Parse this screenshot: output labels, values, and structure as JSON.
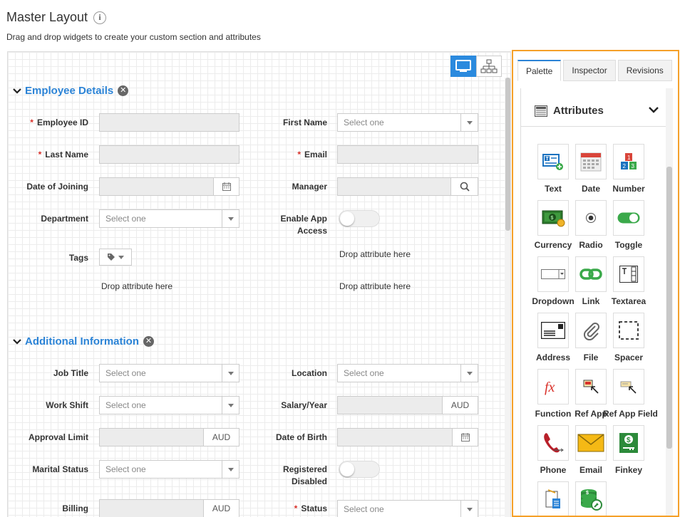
{
  "header": {
    "title": "Master Layout",
    "info_glyph": "i",
    "subtitle": "Drag and drop widgets to create your custom section and attributes"
  },
  "colors": {
    "accent": "#2b83d6",
    "panel_border": "#f5a029",
    "required": "#d9322b"
  },
  "sections": {
    "employee": {
      "title": "Employee Details",
      "fields": {
        "employee_id": {
          "label": "Employee ID",
          "required": "*"
        },
        "first_name": {
          "label": "First Name",
          "placeholder": "Select one"
        },
        "last_name": {
          "label": "Last Name",
          "required": "*"
        },
        "email": {
          "label": "Email",
          "required": "*"
        },
        "date_of_joining": {
          "label": "Date of Joining",
          "icon": "calendar-icon"
        },
        "manager": {
          "label": "Manager",
          "icon": "search-icon"
        },
        "department": {
          "label": "Department",
          "placeholder": "Select one"
        },
        "enable_app_access": {
          "label_line1": "Enable App",
          "label_line2": "Access"
        },
        "tags": {
          "label": "Tags",
          "icon": "tag-icon"
        }
      },
      "drop_right": "Drop attribute here",
      "drop_left": "Drop attribute here",
      "drop_right2": "Drop attribute here"
    },
    "additional": {
      "title": "Additional Information",
      "fields": {
        "job_title": {
          "label": "Job Title",
          "placeholder": "Select one"
        },
        "location": {
          "label": "Location",
          "placeholder": "Select one"
        },
        "work_shift": {
          "label": "Work Shift",
          "placeholder": "Select one"
        },
        "salary_year": {
          "label": "Salary/Year",
          "addon": "AUD"
        },
        "approval_limit": {
          "label": "Approval Limit",
          "addon": "AUD"
        },
        "date_of_birth": {
          "label": "Date of Birth",
          "icon": "calendar-icon"
        },
        "marital_status": {
          "label": "Marital Status",
          "placeholder": "Select one"
        },
        "registered": {
          "label_line1": "Registered",
          "label_line2": "Disabled"
        },
        "billing": {
          "label": "Billing",
          "addon": "AUD"
        },
        "status": {
          "label": "Status",
          "required": "*",
          "placeholder": "Select one"
        }
      }
    }
  },
  "panel": {
    "tabs": [
      "Palette",
      "Inspector",
      "Revisions"
    ],
    "attributes_title": "Attributes",
    "widgets": [
      {
        "label": "Text",
        "icon": "text-widget-icon"
      },
      {
        "label": "Date",
        "icon": "calendar-grid-icon"
      },
      {
        "label": "Number",
        "icon": "number-blocks-icon"
      },
      {
        "label": "Currency",
        "icon": "money-icon"
      },
      {
        "label": "Radio",
        "icon": "radio-icon"
      },
      {
        "label": "Toggle",
        "icon": "toggle-icon"
      },
      {
        "label": "Dropdown",
        "icon": "dropdown-icon"
      },
      {
        "label": "Link",
        "icon": "chain-link-icon"
      },
      {
        "label": "Textarea",
        "icon": "textarea-icon"
      },
      {
        "label": "Address",
        "icon": "address-card-icon"
      },
      {
        "label": "File",
        "icon": "paperclip-icon"
      },
      {
        "label": "Spacer",
        "icon": "spacer-icon"
      },
      {
        "label": "Function",
        "icon": "function-icon"
      },
      {
        "label": "Ref App",
        "icon": "ref-app-icon"
      },
      {
        "label": "Ref App Field",
        "icon": "ref-app-field-icon"
      },
      {
        "label": "Phone",
        "icon": "phone-icon"
      },
      {
        "label": "Email",
        "icon": "envelope-icon"
      },
      {
        "label": "Finkey",
        "icon": "finkey-icon"
      },
      {
        "label": "",
        "icon": "calculator-doc-icon"
      },
      {
        "label": "",
        "icon": "coins-key-icon"
      }
    ]
  }
}
